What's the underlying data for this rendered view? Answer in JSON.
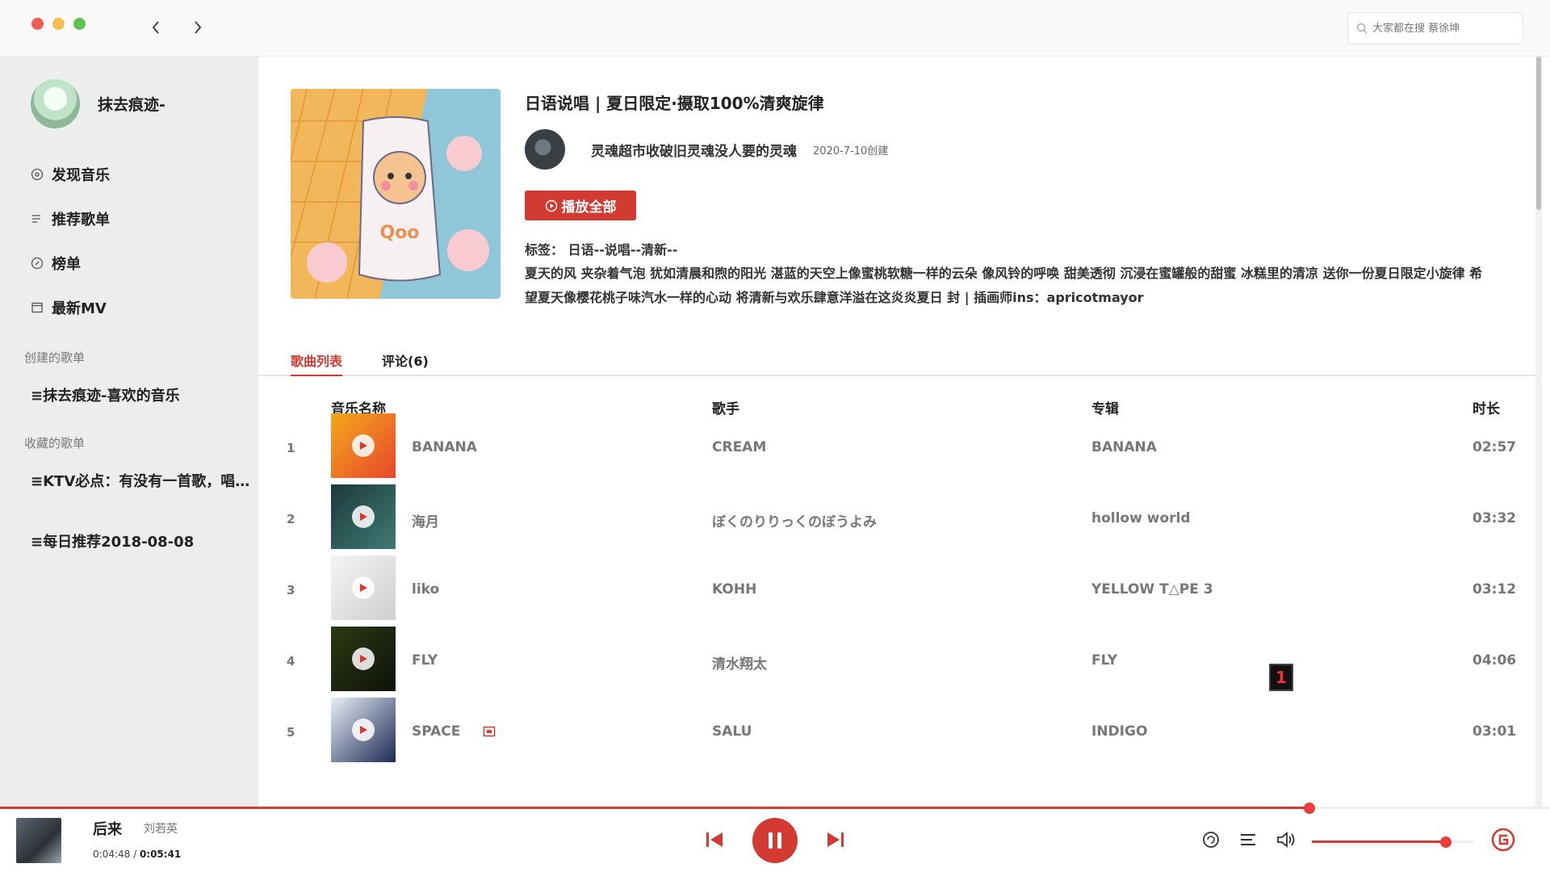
{
  "search": {
    "placeholder": "大家都在搜 蔡徐坤"
  },
  "sidebar": {
    "user_name": "抹去痕迹-",
    "menu": [
      {
        "label": "发现音乐",
        "icon": "disc-icon"
      },
      {
        "label": "推荐歌单",
        "icon": "playlist-icon"
      },
      {
        "label": "榜单",
        "icon": "chart-icon"
      },
      {
        "label": "最新MV",
        "icon": "video-icon"
      }
    ],
    "created_title": "创建的歌单",
    "created": [
      "抹去痕迹-喜欢的音乐"
    ],
    "collected_title": "收藏的歌单",
    "collected": [
      "KTV必点：有没有一首歌，唱出你的心声",
      "每日推荐2018-08-08"
    ]
  },
  "playlist": {
    "title": "日语说唱 | 夏日限定·摄取100%清爽旋律",
    "creator": "灵魂超市收破旧灵魂没人要的灵魂",
    "created_date": "2020-7-10创建",
    "play_all": "播放全部",
    "tags_label": "标签：",
    "tags": "日语--说唱--清新--",
    "description": "夏天的风 夹杂着气泡 犹如清晨和煦的阳光 湛蓝的天空上像蜜桃软糖一样的云朵 像风铃的呼唤 甜美透彻 沉浸在蜜罐般的甜蜜 冰糕里的清凉 送你一份夏日限定小旋律 希望夏天像樱花桃子味汽水一样的心动 将清新与欢乐肆意洋溢在这炎炎夏日 封 | 插画师ins：apricotmayor"
  },
  "tabs": {
    "songs": "歌曲列表",
    "comments": "评论(6)"
  },
  "columns": {
    "name": "音乐名称",
    "artist": "歌手",
    "album": "专辑",
    "duration": "时长"
  },
  "songs": [
    {
      "num": "1",
      "name": "BANANA",
      "artist": "CREAM",
      "album": "BANANA",
      "duration": "02:57",
      "thumb_color": "#f2a81b",
      "thumb_color2": "#e8472c"
    },
    {
      "num": "2",
      "name": "海月",
      "artist": "ぼくのりりっくのぼうよみ",
      "album": "hollow world",
      "duration": "03:32",
      "thumb_color": "#1d3a3a",
      "thumb_color2": "#3f7a75"
    },
    {
      "num": "3",
      "name": "liko",
      "artist": "KOHH",
      "album": "YELLOW T△PE 3",
      "duration": "03:12",
      "thumb_color": "#f4f4f4",
      "thumb_color2": "#cfcfcf"
    },
    {
      "num": "4",
      "name": "FLY",
      "artist": "清水翔太",
      "album": "FLY",
      "duration": "04:06",
      "thumb_color": "#2c3a12",
      "thumb_color2": "#0e120a"
    },
    {
      "num": "5",
      "name": "SPACE",
      "artist": "SALU",
      "album": "INDIGO",
      "duration": "03:01",
      "thumb_color": "#e9eef6",
      "thumb_color2": "#1c2a55"
    }
  ],
  "side_badge": "1",
  "player": {
    "title": "后来",
    "artist": "刘若英",
    "current_time": "0:04:48",
    "separator": " / ",
    "total_time": "0:05:41",
    "progress": 0.845,
    "volume": 0.83
  },
  "colors": {
    "accent": "#d33a31"
  }
}
